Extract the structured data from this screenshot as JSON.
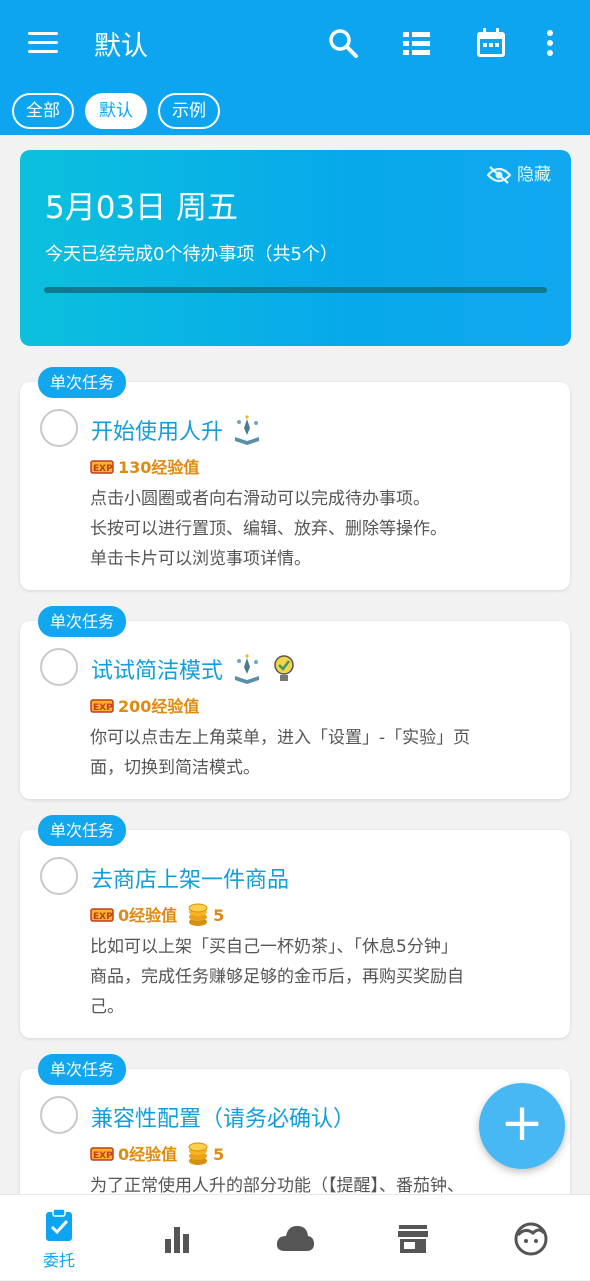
{
  "header": {
    "title": "默认",
    "icons": [
      "menu-icon",
      "search-icon",
      "list-view-icon",
      "calendar-icon",
      "more-vert-icon"
    ]
  },
  "chips": [
    {
      "label": "全部",
      "active": false
    },
    {
      "label": "默认",
      "active": true
    },
    {
      "label": "示例",
      "active": false
    }
  ],
  "summary": {
    "hide_label": "隐藏",
    "date": "5月03日 周五",
    "progress_text": "今天已经完成0个待办事项（共5个）",
    "progress": 0
  },
  "tasks": [
    {
      "badge": "单次任务",
      "title": "开始使用人升",
      "exp": "130经验值",
      "coins": "",
      "desc": [
        "点击小圆圈或者向右滑动可以完成待办事项。",
        "长按可以进行置顶、编辑、放弃、删除等操作。",
        "单击卡片可以浏览事项详情。"
      ]
    },
    {
      "badge": "单次任务",
      "title": "试试简洁模式",
      "exp": "200经验值",
      "coins": "",
      "desc": [
        "你可以点击左上角菜单，进入「设置」-「实验」页",
        "面，切换到简洁模式。"
      ]
    },
    {
      "badge": "单次任务",
      "title": "去商店上架一件商品",
      "exp": "0经验值",
      "coins": "5",
      "desc": [
        "比如可以上架「买自己一杯奶茶」、「休息5分钟」",
        "商品，完成任务赚够足够的金币后，再购买奖励自",
        "己。"
      ]
    },
    {
      "badge": "单次任务",
      "title": "兼容性配置（请务必确认）",
      "exp": "0经验值",
      "coins": "5",
      "desc": [
        "为了正常使用人升的部分功能（【提醒】、番茄钟、"
      ]
    }
  ],
  "fab": {
    "label": "+"
  },
  "bottom_nav": [
    {
      "label": "委托",
      "icon": "task-clipboard-icon",
      "active": true
    },
    {
      "label": "",
      "icon": "bar-chart-icon",
      "active": false
    },
    {
      "label": "",
      "icon": "cloud-icon",
      "active": false
    },
    {
      "label": "",
      "icon": "store-icon",
      "active": false
    },
    {
      "label": "",
      "icon": "face-icon",
      "active": false
    }
  ],
  "colors": {
    "primary": "#0ea5f0",
    "title": "#119ed9",
    "exp": "#e08a0f"
  }
}
